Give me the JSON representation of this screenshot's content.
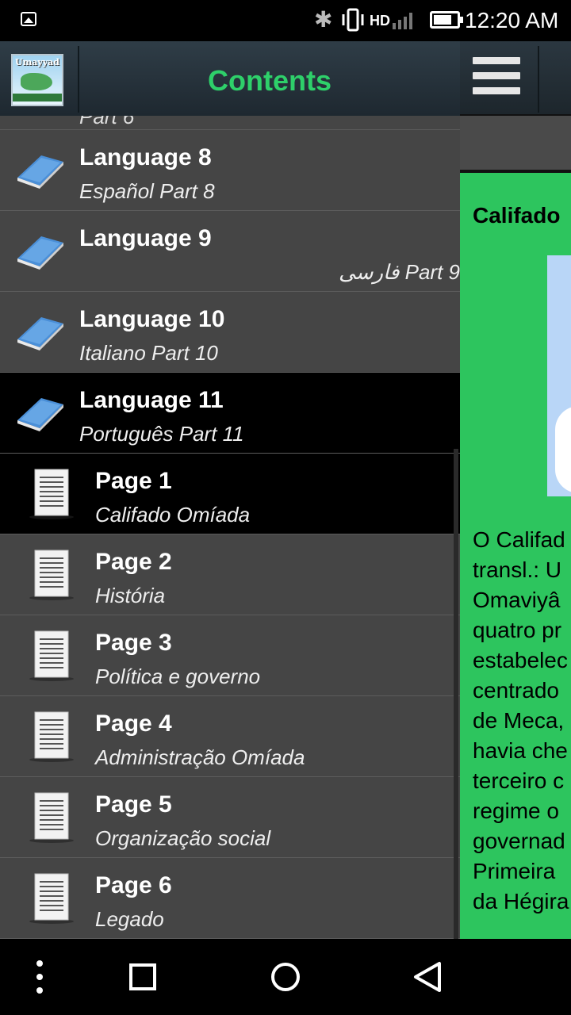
{
  "status_bar": {
    "time": "12:20 AM",
    "network_label": "HD",
    "icons": [
      "gallery-icon",
      "bluetooth-icon",
      "vibrate-icon",
      "signal-icon",
      "battery-icon"
    ]
  },
  "drawer": {
    "title": "Contents",
    "logo_text": "Umayyad",
    "partial_item_text": "Part 6",
    "items": [
      {
        "title": "Language 8",
        "subtitle": "Español Part 8",
        "icon": "book-icon"
      },
      {
        "title": "Language 9",
        "subtitle": "Part 9 فارسی",
        "icon": "book-icon"
      },
      {
        "title": "Language 10",
        "subtitle": "Italiano Part 10",
        "icon": "book-icon"
      },
      {
        "title": "Language 11",
        "subtitle": "Português Part 11",
        "icon": "book-icon"
      }
    ],
    "pages": [
      {
        "title": "Page 1",
        "subtitle": "Califado Omíada",
        "icon": "document-icon"
      },
      {
        "title": "Page 2",
        "subtitle": "História",
        "icon": "document-icon"
      },
      {
        "title": "Page 3",
        "subtitle": "Política e governo",
        "icon": "document-icon"
      },
      {
        "title": "Page 4",
        "subtitle": "Administração Omíada",
        "icon": "document-icon"
      },
      {
        "title": "Page 5",
        "subtitle": "Organização social",
        "icon": "document-icon"
      },
      {
        "title": "Page 6",
        "subtitle": "Legado",
        "icon": "document-icon"
      }
    ],
    "selected_language": "Language 11",
    "selected_page": "Page 1"
  },
  "main": {
    "article_title": "Califado",
    "article_lines": [
      "O Califad",
      "transl.: U",
      "Omaviyâ",
      "quatro pr",
      "estabelec",
      "centrado",
      "de Meca,",
      "havia che",
      "terceiro c",
      "regime o",
      "governad",
      "Primeira",
      "da Hégira"
    ]
  },
  "nav_bar": {
    "buttons": [
      "more-icon",
      "recents-icon",
      "home-icon",
      "back-icon"
    ]
  },
  "colors": {
    "accent_green": "#2ed06a",
    "content_green": "#2dc55e",
    "drawer_bg": "#454545",
    "selected_bg": "#000000"
  }
}
